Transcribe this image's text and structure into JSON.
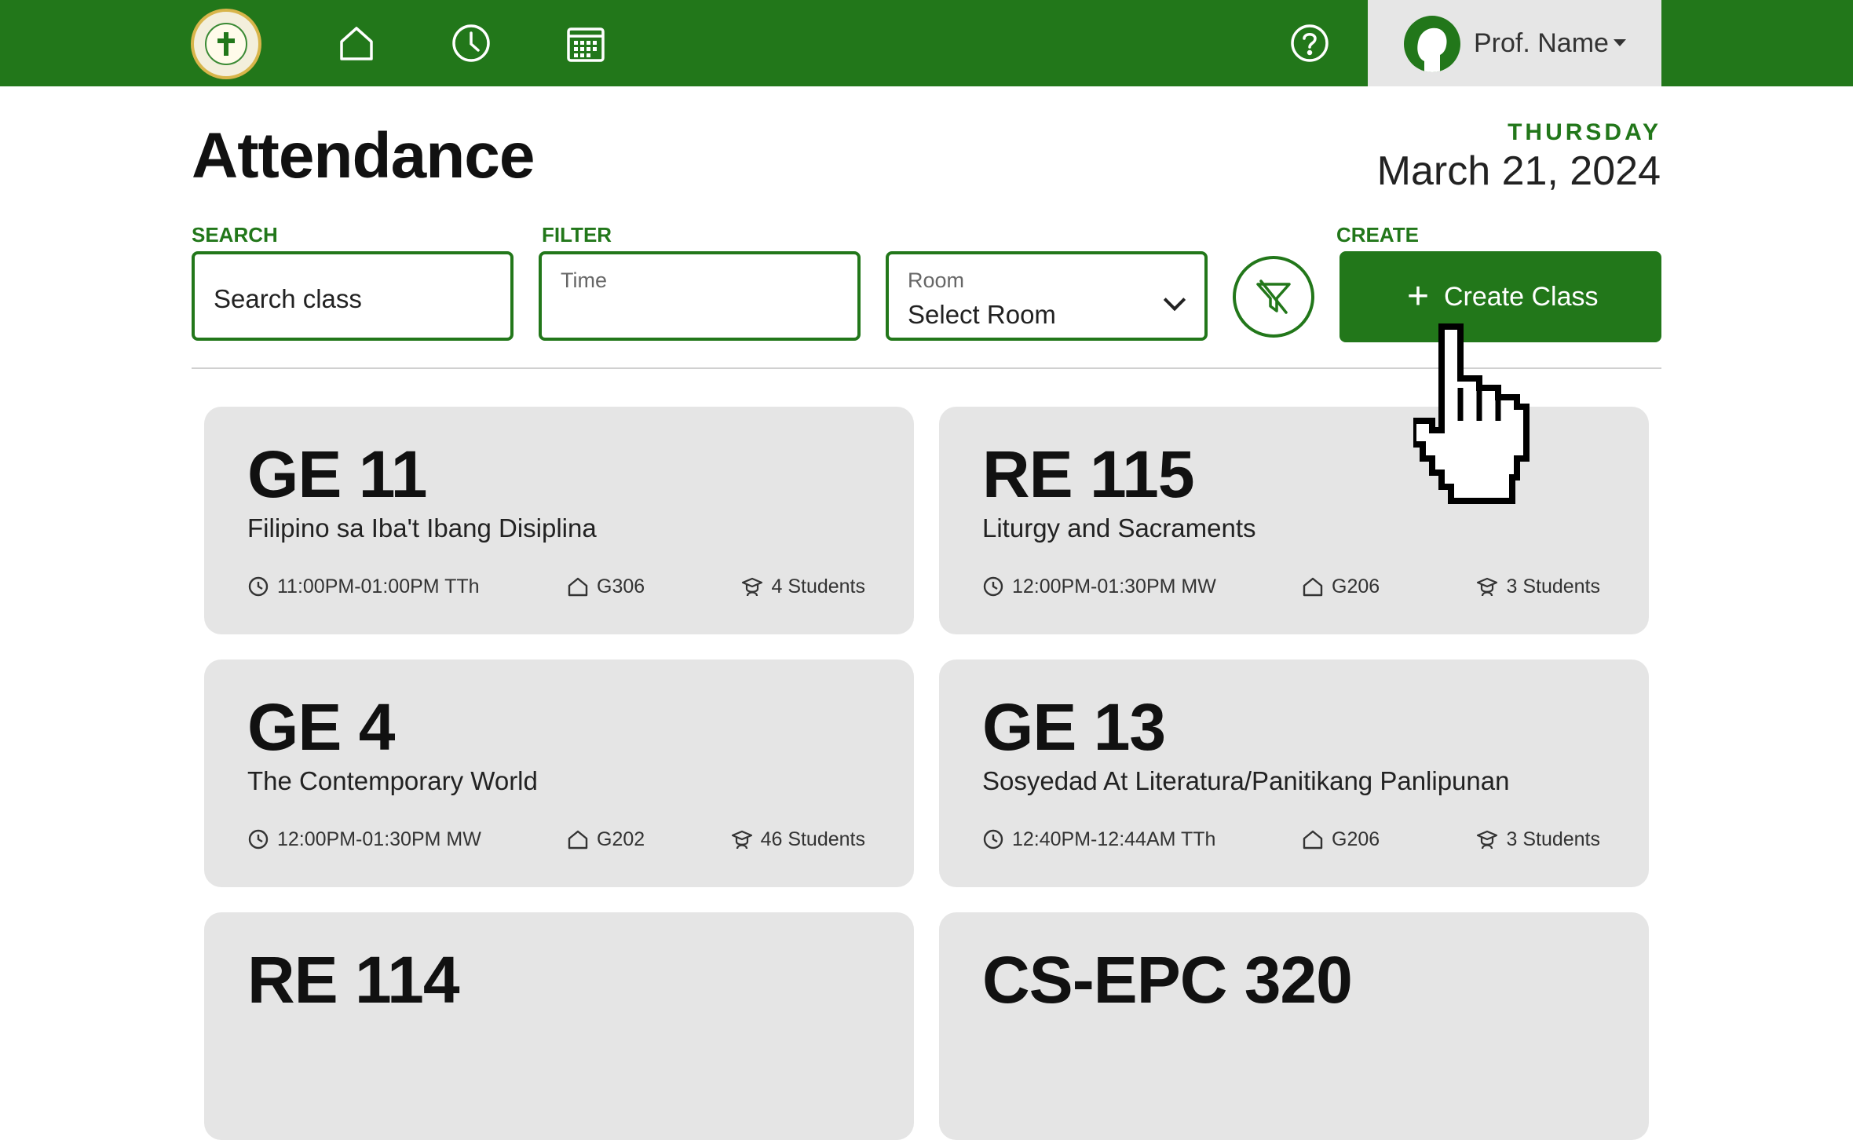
{
  "nav": {
    "icons": [
      "school-seal-logo",
      "home-icon",
      "clock-icon",
      "calendar-icon",
      "help-icon"
    ],
    "profile_name": "Prof. Name"
  },
  "header": {
    "title": "Attendance",
    "weekday": "THURSDAY",
    "date": "March 21, 2024"
  },
  "search": {
    "label": "SEARCH",
    "placeholder": "Search class"
  },
  "filter": {
    "label": "FILTER",
    "time_label": "Time",
    "time_value": "",
    "room_label": "Room",
    "room_value": "Select Room"
  },
  "create": {
    "label": "CREATE",
    "button_label": "Create Class",
    "button_icon": "+"
  },
  "colors": {
    "primary": "#22771a",
    "card_bg": "#e5e5e5",
    "profile_bg": "#e6e6e6"
  },
  "classes": [
    {
      "code": "GE 11",
      "name": "Filipino sa Iba't Ibang Disiplina",
      "time": "11:00PM-01:00PM TTh",
      "room": "G306",
      "students": "4 Students"
    },
    {
      "code": "RE 115",
      "name": "Liturgy and Sacraments",
      "time": "12:00PM-01:30PM MW",
      "room": "G206",
      "students": "3 Students"
    },
    {
      "code": "GE 4",
      "name": "The Contemporary World",
      "time": "12:00PM-01:30PM MW",
      "room": "G202",
      "students": "46 Students"
    },
    {
      "code": "GE 13",
      "name": "Sosyedad At Literatura/Panitikang Panlipunan",
      "time": "12:40PM-12:44AM TTh",
      "room": "G206",
      "students": "3 Students"
    },
    {
      "code": "RE 114",
      "name": "",
      "time": "",
      "room": "",
      "students": ""
    },
    {
      "code": "CS-EPC 320",
      "name": "",
      "time": "",
      "room": "",
      "students": ""
    }
  ]
}
